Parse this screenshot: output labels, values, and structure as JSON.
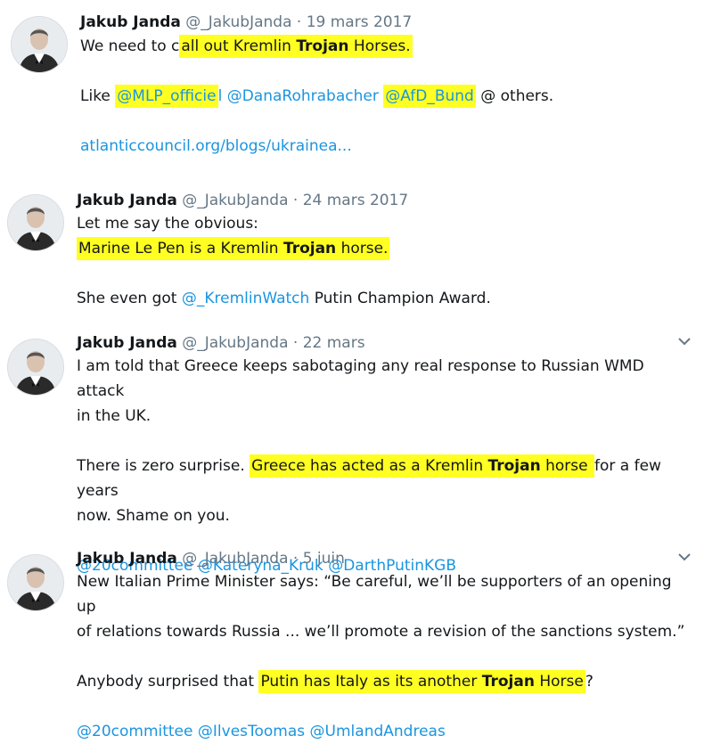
{
  "tweets": [
    {
      "author": "Jakub Janda",
      "handle": "@_JakubJanda",
      "date": "· 19 mars 2017",
      "line1_pre": "We need to c",
      "line1_hl": "all out Kremlin ",
      "line1_bold": "Trojan",
      "line1_hl2": " Horses.",
      "line2_pre": "Like ",
      "mention1_a": "@MLP_officie",
      "mention1_b": "l",
      "mention2": "@DanaRohrabacher",
      "mention3": "@AfD_Bund",
      "line2_post": " @ others.",
      "url": "atlanticcouncil.org/blogs/ukrainea..."
    },
    {
      "author": "Jakub Janda",
      "handle": "@_JakubJanda",
      "date": "· 24 mars 2017",
      "line1": "Let me say the obvious:",
      "line2_hl": "Marine Le Pen is a Kremlin ",
      "line2_bold": "Trojan",
      "line2_hl2": " horse.",
      "line3_pre": "She even got ",
      "mention": "@_KremlinWatch",
      "line3_post": " Putin Champion Award."
    },
    {
      "author": "Jakub Janda",
      "handle": "@_JakubJanda",
      "date": "· 22 mars",
      "line1": "I am told that Greece keeps sabotaging any real response to Russian WMD attack",
      "line2": "in the UK.",
      "line3_pre": "There is zero surprise. ",
      "line3_hl": "Greece has acted as a Kremlin ",
      "line3_bold": "Trojan",
      "line3_hl2": " horse ",
      "line3_post": "for a few years",
      "line4": "now. Shame on you.",
      "mentions": [
        "@20committee",
        "@Kateryna_Kruk",
        "@DarthPutinKGB"
      ]
    },
    {
      "author": "Jakub Janda",
      "handle": "@_JakubJanda",
      "date": "· 5 juin",
      "line1": "New Italian Prime Minister says:  “Be careful, we’ll be supporters of an opening up",
      "line2": "of relations towards Russia ... we’ll promote a revision of the sanctions system.”",
      "line3_pre": "Anybody surprised that ",
      "line3_hl": "Putin has Italy as its another ",
      "line3_bold": "Trojan",
      "line3_hl2": " Horse",
      "line3_post": "?",
      "mentions": [
        "@20committee",
        "@IlvesToomas",
        "@UmlandAndreas"
      ]
    }
  ],
  "icons": {
    "avatar": "profile-photo",
    "chevron": "chevron-down-icon"
  },
  "colors": {
    "link": "#1b95e0",
    "highlight": "#ffff22",
    "meta": "#657786"
  }
}
